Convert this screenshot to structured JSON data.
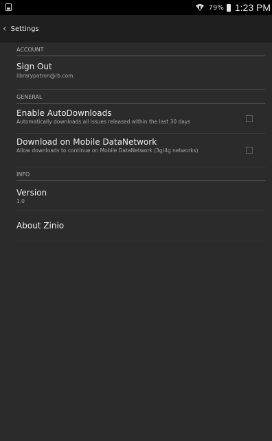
{
  "status_bar": {
    "battery_percent": "79%",
    "time": "1:23 PM"
  },
  "action_bar": {
    "title": "Settings"
  },
  "sections": [
    {
      "header": "ACCOUNT",
      "items": [
        {
          "title": "Sign Out",
          "subtitle": "librarypatron@rb.com"
        }
      ]
    },
    {
      "header": "GENERAL",
      "items": [
        {
          "title": "Enable AutoDownloads",
          "subtitle": "Automatically downloads all issues released within the last 30 days",
          "checked": false
        },
        {
          "title": "Download on Mobile DataNetwork",
          "subtitle": "Allow downloads to continue on Mobile DataNetwork (3g/4g networks)",
          "checked": false
        }
      ]
    },
    {
      "header": "INFO",
      "items": [
        {
          "title": "Version",
          "subtitle": "1.0"
        },
        {
          "title": "About Zinio"
        }
      ]
    }
  ],
  "colors": {
    "background": "#2b2b2b",
    "status_bar": "#000000",
    "action_bar": "#1e1e1e"
  }
}
